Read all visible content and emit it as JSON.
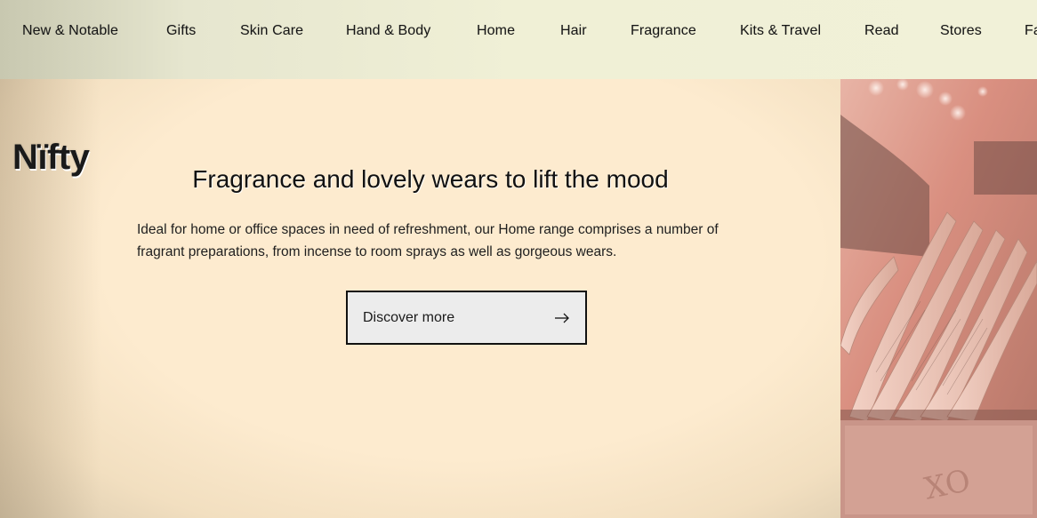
{
  "nav": {
    "items": [
      {
        "label": "New & Notable"
      },
      {
        "label": "Gifts"
      },
      {
        "label": "Skin Care"
      },
      {
        "label": "Hand & Body"
      },
      {
        "label": "Home"
      },
      {
        "label": "Hair"
      },
      {
        "label": "Fragrance"
      },
      {
        "label": "Kits & Travel"
      },
      {
        "label": "Read"
      },
      {
        "label": "Stores"
      },
      {
        "label": "Fa"
      }
    ]
  },
  "hero": {
    "brand": "Nïfty",
    "headline": "Fragrance and lovely wears to lift the mood",
    "description": "Ideal for home or office spaces in need of refreshment, our Home range comprises a number of fragrant preparations, from incense to room sprays as well as gorgeous wears.",
    "cta_label": "Discover more",
    "cta_icon": "arrow-right-icon"
  },
  "image": {
    "subject": "open-book-photo",
    "card_text": "XO"
  },
  "colors": {
    "background": "#fdebcf",
    "nav_background": "#f0f0d6",
    "button_background": "#ececec",
    "text": "#161616"
  }
}
